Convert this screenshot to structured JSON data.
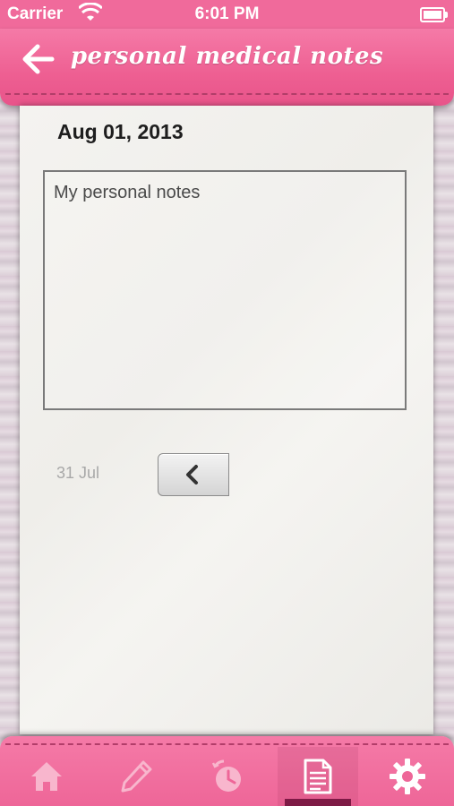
{
  "status_bar": {
    "carrier": "Carrier",
    "time": "6:01 PM"
  },
  "header": {
    "title": "personal medical notes",
    "back_icon": "back-arrow-icon"
  },
  "note": {
    "date": "Aug 01, 2013",
    "text": "My personal notes"
  },
  "navigation": {
    "previous_date": "31 Jul",
    "previous_icon": "chevron-left-icon"
  },
  "tabbar": {
    "tabs": [
      {
        "icon": "home-icon",
        "active": false
      },
      {
        "icon": "pencil-icon",
        "active": false
      },
      {
        "icon": "reminder-clock-icon",
        "active": false
      },
      {
        "icon": "notes-document-icon",
        "active": true
      },
      {
        "icon": "gear-icon",
        "active": false
      }
    ]
  },
  "colors": {
    "accent": "#ee5f92",
    "active_indicator": "#7e1a45"
  }
}
